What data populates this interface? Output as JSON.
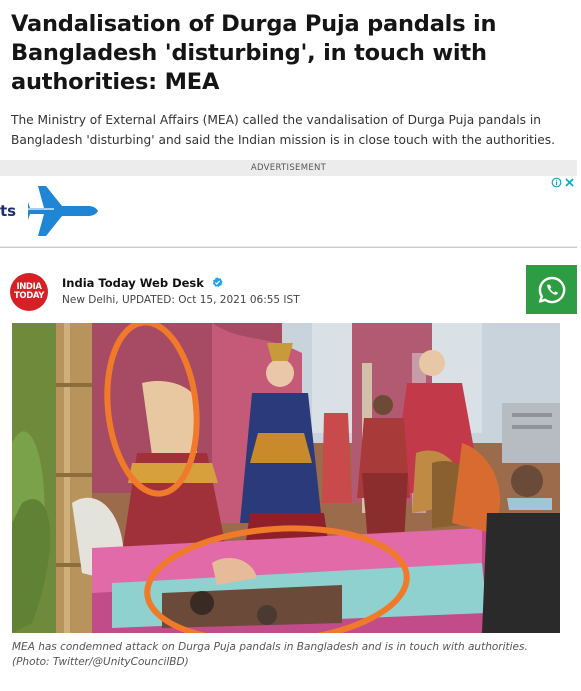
{
  "article": {
    "headline": "Vandalisation of Durga Puja pandals in Bangladesh 'disturbing', in touch with authorities: MEA",
    "summary": "The Ministry of External Affairs (MEA) called the vandalisation of Durga Puja pandals in Bangladesh 'disturbing' and said the Indian mission is in close touch with the authorities."
  },
  "ad": {
    "label": "ADVERTISEMENT",
    "text": "ts",
    "icons": [
      "adchoices-info-icon",
      "ad-close-icon"
    ]
  },
  "author": {
    "logo_line1": "INDIA",
    "logo_line2": "TODAY",
    "name": "India Today Web Desk",
    "meta": "New Delhi, UPDATED: Oct 15, 2021 06:55 IST"
  },
  "share": {
    "icon": "whatsapp-icon"
  },
  "photo": {
    "caption": "MEA has condemned attack on Durga Puja pandals in Bangladesh and is in touch with authorities. (Photo: Twitter/@UnityCouncilBD)"
  },
  "colors": {
    "brand_red": "#d71f26",
    "whatsapp_green": "#2e9c43",
    "ad_navy": "#1d2f6b",
    "plane_blue": "#1f86d6",
    "annotation_orange": "#f07a2a"
  }
}
